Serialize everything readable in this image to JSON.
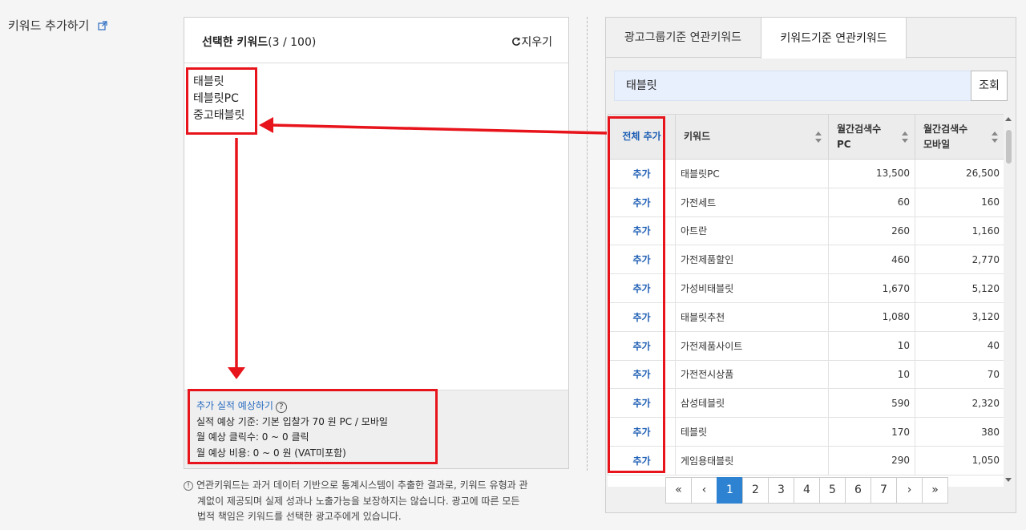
{
  "page_title": "키워드 추가하기",
  "selected": {
    "title_bold": "선택한 키워드",
    "title_count": "(3 / 100)",
    "clear_label": "지우기",
    "keywords": [
      "태블릿",
      "테블릿PC",
      "중고태블릿"
    ]
  },
  "forecast": {
    "link": "추가 실적 예상하기",
    "help": "?",
    "line1": "실적 예상 기준:  기본 입찰가 70 원 PC / 모바일",
    "line2": "월 예상 클릭수: 0 ~ 0  클릭",
    "line3": "월 예상 비용: 0 ~ 0  원 (VAT미포함)"
  },
  "notice": {
    "icon": "!",
    "line1": "연관키워드는 과거 데이터 기반으로 통계시스템이 추출한 결과로, 키워드 유형과 관",
    "line2": "계없이 제공되며 실제 성과나 노출가능을 보장하지는 않습니다. 광고에 따른 모든",
    "line3": "법적 책임은 키워드를 선택한 광고주에게 있습니다."
  },
  "tabs": [
    {
      "label": "광고그룹기준 연관키워드"
    },
    {
      "label": "키워드기준 연관키워드"
    }
  ],
  "search": {
    "value": "태블릿",
    "button": "조회"
  },
  "table": {
    "headers": {
      "add_all": "전체 추가",
      "keyword": "키워드",
      "pc_line1": "월간검색수",
      "pc_line2": "PC",
      "mobile_line1": "월간검색수",
      "mobile_line2": "모바일"
    },
    "add_label": "추가",
    "rows": [
      {
        "keyword": "태블릿PC",
        "pc": "13,500",
        "mobile": "26,500"
      },
      {
        "keyword": "가전세트",
        "pc": "60",
        "mobile": "160"
      },
      {
        "keyword": "아트란",
        "pc": "260",
        "mobile": "1,160"
      },
      {
        "keyword": "가전제품할인",
        "pc": "460",
        "mobile": "2,770"
      },
      {
        "keyword": "가성비태블릿",
        "pc": "1,670",
        "mobile": "5,120"
      },
      {
        "keyword": "태블릿추천",
        "pc": "1,080",
        "mobile": "3,120"
      },
      {
        "keyword": "가전제품사이트",
        "pc": "10",
        "mobile": "40"
      },
      {
        "keyword": "가전전시상품",
        "pc": "10",
        "mobile": "70"
      },
      {
        "keyword": "삼성테블릿",
        "pc": "590",
        "mobile": "2,320"
      },
      {
        "keyword": "테블릿",
        "pc": "170",
        "mobile": "380"
      },
      {
        "keyword": "게임용태블릿",
        "pc": "290",
        "mobile": "1,050"
      }
    ]
  },
  "pagination": {
    "first": "«",
    "prev": "‹",
    "pages": [
      "1",
      "2",
      "3",
      "4",
      "5",
      "6",
      "7"
    ],
    "current": "1",
    "next": "›",
    "last": "»"
  },
  "colors": {
    "annotation": "#e8141b",
    "link": "#2a6cc0",
    "active_page": "#2d82d2",
    "search_bg": "#e8f0fd"
  }
}
